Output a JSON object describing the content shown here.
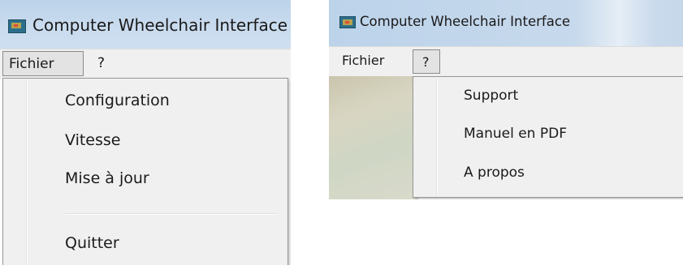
{
  "window": {
    "title": "Computer Wheelchair Interface",
    "app_icon": "computer-monitor-icon"
  },
  "menubar": {
    "fichier_label": "Fichier",
    "help_label": "?"
  },
  "fichier_menu": {
    "items": [
      "Configuration",
      "Vitesse",
      "Mise à jour",
      "Quitter"
    ]
  },
  "help_menu": {
    "items": [
      "Support",
      "Manuel en PDF",
      "A propos"
    ]
  },
  "colors": {
    "titlebar": "#c9dbee",
    "menu_background": "#f0f0f0",
    "active_menu_border": "#8a8a8a"
  }
}
